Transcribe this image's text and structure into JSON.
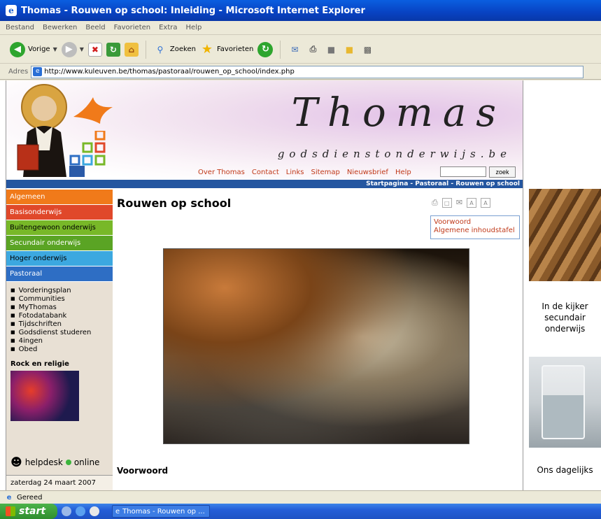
{
  "window": {
    "title": "Thomas - Rouwen op school: Inleiding - Microsoft Internet Explorer"
  },
  "menu": [
    "Bestand",
    "Bewerken",
    "Beeld",
    "Favorieten",
    "Extra",
    "Help"
  ],
  "toolbar": {
    "back_label": "Vorige",
    "search_label": "Zoeken",
    "favorites_label": "Favorieten"
  },
  "address": {
    "label": "Adres",
    "url": "http://www.kuleuven.be/thomas/pastoraal/rouwen_op_school/index.php"
  },
  "header": {
    "title": "Thomas",
    "subtitle": "godsdienstonderwijs.be",
    "nav": [
      "Over Thomas",
      "Contact",
      "Links",
      "Sitemap",
      "Nieuwsbrief",
      "Help"
    ],
    "search_button": "zoek",
    "breadcrumb": "Startpagina - Pastoraal - Rouwen op school"
  },
  "sidebar": {
    "items": [
      {
        "label": "Algemeen",
        "color": "#f07a1a"
      },
      {
        "label": "Basisonderwijs",
        "color": "#e0482a"
      },
      {
        "label": "Buitengewoon onderwijs",
        "color": "#78b828"
      },
      {
        "label": "Secundair onderwijs",
        "color": "#5aa424"
      },
      {
        "label": "Hoger onderwijs",
        "color": "#3ca8e0"
      },
      {
        "label": "Pastoraal",
        "color": "#2e6ec4"
      }
    ],
    "subitems": [
      "Vorderingsplan",
      "Communities",
      "MyThomas",
      "Fotodatabank",
      "Tijdschriften",
      "Godsdienst studeren",
      "4ingen",
      "Obed"
    ],
    "rock_title": "Rock en religie",
    "helpdesk": {
      "label": "helpdesk",
      "status": "online"
    },
    "date": "zaterdag 24 maart 2007"
  },
  "main": {
    "title": "Rouwen op school",
    "links": [
      "Voorwoord",
      "Algemene inhoudstafel"
    ],
    "section_title": "Voorwoord"
  },
  "rightbar": {
    "text1": "In de kijker secundair onderwijs",
    "text2": "Ons dagelijks"
  },
  "status": {
    "text": "Gereed"
  },
  "taskbar": {
    "start": "start",
    "item": "Thomas - Rouwen op ..."
  }
}
